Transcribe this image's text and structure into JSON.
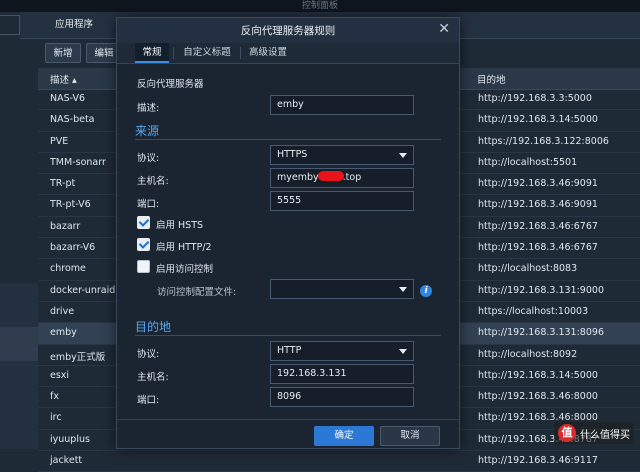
{
  "window": {
    "title": "控制面板"
  },
  "background": {
    "tab": "应用程序",
    "buttons": {
      "add": "新增",
      "edit": "编辑"
    },
    "columns": {
      "description": "描述 ▴",
      "destination": "目的地"
    },
    "rows": [
      {
        "name": "NAS-V6",
        "url": "http://192.168.3.3:5000"
      },
      {
        "name": "NAS-beta",
        "url": "http://192.168.3.14:5000"
      },
      {
        "name": "PVE",
        "url": "https://192.168.3.122:8006"
      },
      {
        "name": "TMM-sonarr",
        "url": "http://localhost:5501"
      },
      {
        "name": "TR-pt",
        "url": "http://192.168.3.46:9091"
      },
      {
        "name": "TR-pt-V6",
        "url": "http://192.168.3.46:9091"
      },
      {
        "name": "bazarr",
        "url": "http://192.168.3.46:6767"
      },
      {
        "name": "bazarr-V6",
        "url": "http://192.168.3.46:6767"
      },
      {
        "name": "chrome",
        "url": "http://localhost:8083"
      },
      {
        "name": "docker-unraid",
        "url": "http://192.168.3.131:9000"
      },
      {
        "name": "drive",
        "url": "https://localhost:10003"
      },
      {
        "name": "emby",
        "url": "http://192.168.3.131:8096"
      },
      {
        "name": "emby正式版",
        "url": "http://localhost:8092"
      },
      {
        "name": "esxi",
        "url": "http://192.168.3.14:5000"
      },
      {
        "name": "fx",
        "url": "http://192.168.3.46:8000"
      },
      {
        "name": "irc",
        "url": "http://192.168.3.46:8000"
      },
      {
        "name": "iyuuplus",
        "url": "http://192.168.3.46:8787"
      },
      {
        "name": "jackett",
        "url": "http://192.168.3.46:9117"
      }
    ],
    "watermark": {
      "logo": "值",
      "text": "什么值得买"
    }
  },
  "modal": {
    "title": "反向代理服务器规则",
    "close": "✕",
    "tabs": [
      "常规",
      "自定义标题",
      "高级设置"
    ],
    "server_heading": "反向代理服务器",
    "description_label": "描述:",
    "description_value": "emby",
    "source": {
      "heading": "来源",
      "protocol_label": "协议:",
      "protocol_value": "HTTPS",
      "hostname_label": "主机名:",
      "hostname_prefix": "myemby",
      "hostname_suffix": ".top",
      "port_label": "端口:",
      "port_value": "5555",
      "hsts_label": "启用 HSTS",
      "http2_label": "启用 HTTP/2",
      "access_control_label": "启用访问控制",
      "access_profile_label": "访问控制配置文件:",
      "access_profile_value": ""
    },
    "destination": {
      "heading": "目的地",
      "protocol_label": "协议:",
      "protocol_value": "HTTP",
      "hostname_label": "主机名:",
      "hostname_value": "192.168.3.131",
      "port_label": "端口:",
      "port_value": "8096"
    },
    "ok": "确定",
    "cancel": "取消"
  },
  "colors": {
    "accent": "#2b78d6",
    "section": "#5aa7f0",
    "redaction": "#e8141b"
  }
}
